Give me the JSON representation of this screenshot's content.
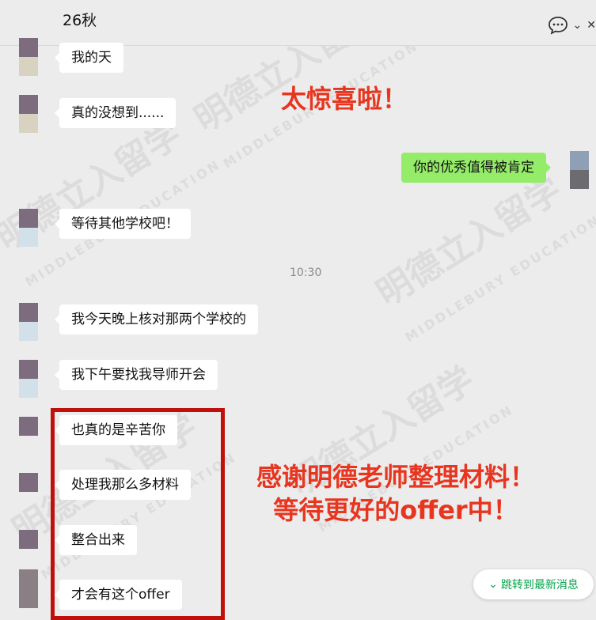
{
  "header": {
    "title": "26秋"
  },
  "messages": {
    "m1": "我的天",
    "m2": "真的没想到......",
    "m3": "你的优秀值得被肯定",
    "m4": "等待其他学校吧！",
    "m5": "我今天晚上核对那两个学校的",
    "m6": "我下午要找我导师开会",
    "m7": "也真的是辛苦你",
    "m8": "处理我那么多材料",
    "m9": "整合出来",
    "m10": "才会有这个offer"
  },
  "timestamp": "10:30",
  "overlay": {
    "top_text": "太惊喜啦！",
    "bottom_line1": "感谢明德老师整理材料！",
    "bottom_line2": "等待更好的offer中！"
  },
  "watermark": {
    "cn": "明德立入留学",
    "en": "MIDDLEBURY EDUCATION"
  },
  "jump_button": {
    "label": "跳转到最新消息"
  },
  "colors": {
    "accent_red": "#e8351f",
    "box_red": "#c0100c",
    "bubble_green": "#95ec69",
    "jump_green": "#07a34b"
  }
}
